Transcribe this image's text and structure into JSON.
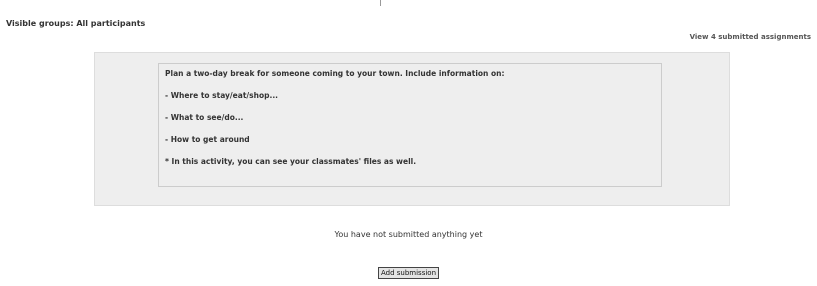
{
  "groups": {
    "label": "Visible groups: All participants"
  },
  "submissions_link": "View 4 submitted assignments",
  "intro": {
    "lines": [
      "Plan a two-day break for someone coming to your town. Include information on:",
      "- Where to stay/eat/shop...",
      "- What to see/do...",
      "- How to get around",
      "* In this activity, you can see your classmates' files as well."
    ]
  },
  "status_text": "You have not submitted anything yet",
  "add_button_label": "Add submission"
}
